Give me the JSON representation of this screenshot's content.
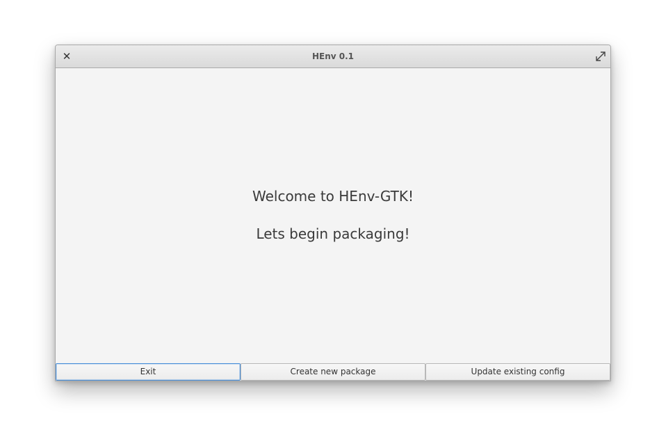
{
  "window": {
    "title": "HEnv 0.1",
    "close_icon": "close-icon",
    "maximize_icon": "maximize-icon"
  },
  "main": {
    "welcome_text": "Welcome to HEnv-GTK!",
    "begin_text": "Lets begin packaging!"
  },
  "buttons": {
    "exit": "Exit",
    "create": "Create new package",
    "update": "Update existing config"
  },
  "colors": {
    "focus_accent": "#4a90d9",
    "background": "#f4f4f4"
  }
}
